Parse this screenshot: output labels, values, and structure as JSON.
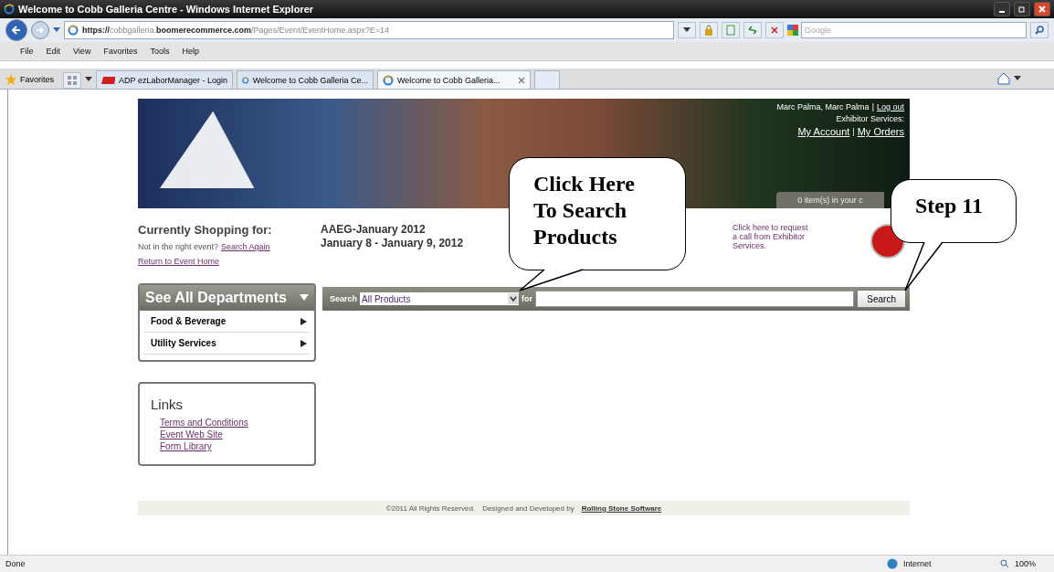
{
  "window": {
    "title": "Welcome to Cobb Galleria Centre - Windows Internet Explorer"
  },
  "address_bar": {
    "url_scheme": "https://",
    "url_host_pre": "cobbgalleria.",
    "url_host": "boomerecommerce.com",
    "url_path": "/Pages/Event/EventHome.aspx?E=14",
    "search_placeholder": "Google"
  },
  "menu": [
    "File",
    "Edit",
    "View",
    "Favorites",
    "Tools",
    "Help"
  ],
  "favorites_bar": {
    "label": "Favorites"
  },
  "tabs": [
    {
      "label": "ADP ezLaborManager - Login",
      "kind": "adp",
      "selected": false
    },
    {
      "label": "Welcome to Cobb Galleria Ce...",
      "kind": "ie",
      "selected": false
    },
    {
      "label": "Welcome to Cobb Galleria...",
      "kind": "ie",
      "selected": true
    }
  ],
  "header": {
    "user": "Marc Palma, Marc Palma",
    "separator": "|",
    "logout": "Log out",
    "services_label": "Exhibitor Services:",
    "my_account": "My Account",
    "my_orders": "My Orders",
    "cart": "0 item(s) in your c"
  },
  "shopping": {
    "heading": "Currently Shopping for:",
    "not_right": "Not in the right event?",
    "search_again": "Search Again",
    "return_link": "Return to Event Home"
  },
  "event": {
    "name": "AAEG-January 2012",
    "dates": "January 8 - January 9, 2012"
  },
  "call_request": "Click here to request a call from Exhibitor Services.",
  "search": {
    "label": "Search",
    "category": "All Products",
    "for_label": "for",
    "button": "Search"
  },
  "departments": {
    "title": "See All Departments",
    "items": [
      "Food & Beverage",
      "Utility Services"
    ]
  },
  "links": {
    "title": "Links",
    "items": [
      "Terms and Conditions",
      "Event Web Site",
      "Form Library"
    ]
  },
  "footer": {
    "rights": "©2011 All Rights Reserved.",
    "designed_by": "Designed and Developed by",
    "developer": "Rolling Stone Software"
  },
  "callouts": [
    {
      "text": "Click Here To Search Products",
      "kind": "search"
    },
    {
      "text": "Step 11",
      "kind": "step"
    }
  ],
  "status_bar": {
    "status": "Done",
    "zone": "Internet",
    "zoom": "100%"
  }
}
